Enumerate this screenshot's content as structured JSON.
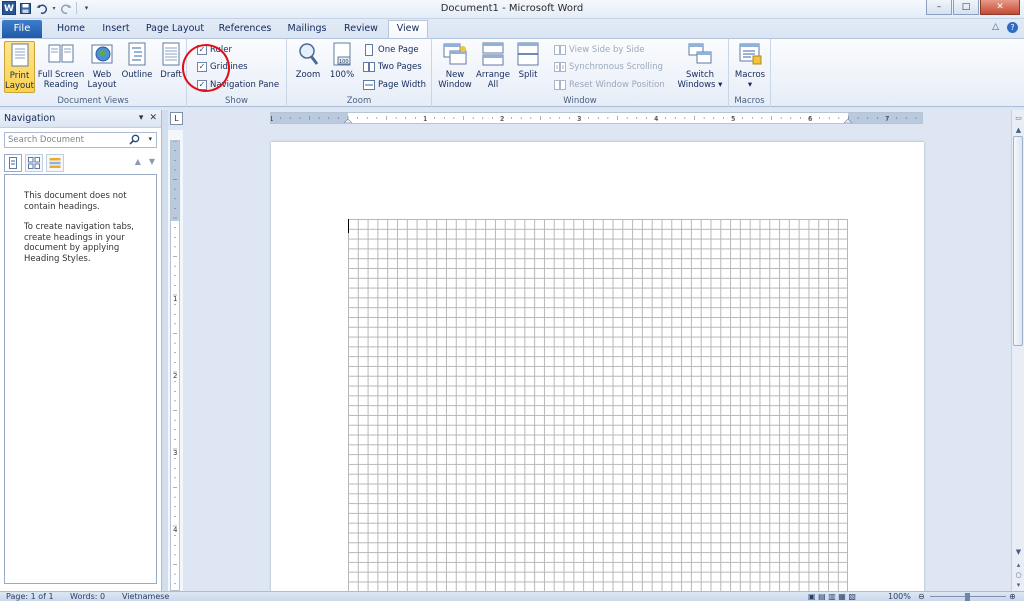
{
  "app": {
    "logo_letter": "W",
    "title": "Document1  -  Microsoft Word"
  },
  "window_controls": {
    "minimize": "–",
    "maximize": "□",
    "close": "✕"
  },
  "tabs": {
    "file": "File",
    "items": [
      "Home",
      "Insert",
      "Page Layout",
      "References",
      "Mailings",
      "Review",
      "View"
    ],
    "active": "View"
  },
  "ribbon": {
    "document_views": {
      "label": "Document Views",
      "print_layout": "Print\nLayout",
      "full_screen_reading": "Full Screen\nReading",
      "web_layout": "Web\nLayout",
      "outline": "Outline",
      "draft": "Draft"
    },
    "show": {
      "label": "Show",
      "ruler": "Ruler",
      "gridlines": "Gridlines",
      "navigation_pane": "Navigation Pane"
    },
    "zoom": {
      "label": "Zoom",
      "zoom": "Zoom",
      "hundred": "100%",
      "one_page": "One Page",
      "two_pages": "Two Pages",
      "page_width": "Page Width"
    },
    "window": {
      "label": "Window",
      "new_window": "New\nWindow",
      "arrange_all": "Arrange\nAll",
      "split": "Split",
      "view_side_by_side": "View Side by Side",
      "synchronous_scrolling": "Synchronous Scrolling",
      "reset_window_position": "Reset Window Position",
      "switch_windows": "Switch\nWindows ▾"
    },
    "macros": {
      "label": "Macros",
      "macros": "Macros\n▾"
    }
  },
  "navigation": {
    "title": "Navigation",
    "search_placeholder": "Search Document",
    "message1": "This document does not contain headings.",
    "message2": "To create navigation tabs, create headings in your document by applying Heading Styles."
  },
  "ruler": {
    "corner": "L",
    "h_numbers": [
      "1",
      "1",
      "2",
      "3",
      "4",
      "5",
      "6",
      "7"
    ],
    "v_numbers": [
      "1",
      "2",
      "3",
      "4"
    ]
  },
  "status": {
    "page": "Page: 1 of 1",
    "words": "Words: 0",
    "language": "Vietnamese",
    "zoom": "100%"
  }
}
